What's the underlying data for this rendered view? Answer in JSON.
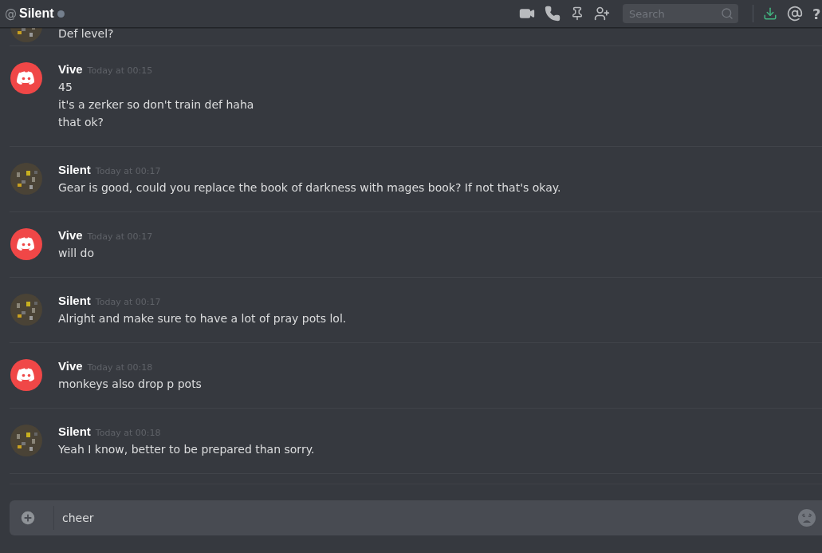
{
  "header": {
    "at": "@",
    "title": "Silent",
    "search": {
      "placeholder": "Search"
    },
    "help": "?"
  },
  "messages": [
    {
      "kind": "picture",
      "lines": [
        "Def level?"
      ]
    },
    {
      "author": "Vive",
      "kind": "discord",
      "time": "Today at 00:15",
      "lines": [
        "45",
        "it's a zerker so don't train def haha",
        "that ok?"
      ]
    },
    {
      "author": "Silent",
      "kind": "picture",
      "time": "Today at 00:17",
      "lines": [
        "Gear is good, could you replace the book of darkness with mages book? If not that's okay."
      ]
    },
    {
      "author": "Vive",
      "kind": "discord",
      "time": "Today at 00:17",
      "lines": [
        "will do"
      ]
    },
    {
      "author": "Silent",
      "kind": "picture",
      "time": "Today at 00:17",
      "lines": [
        "Alright and make sure to have a lot of pray pots lol."
      ]
    },
    {
      "author": "Vive",
      "kind": "discord",
      "time": "Today at 00:18",
      "lines": [
        "monkeys also drop p pots"
      ]
    },
    {
      "author": "Silent",
      "kind": "picture",
      "time": "Today at 00:18",
      "lines": [
        "Yeah I know, better to be prepared than sorry."
      ]
    }
  ],
  "composer": {
    "value": "cheer"
  }
}
